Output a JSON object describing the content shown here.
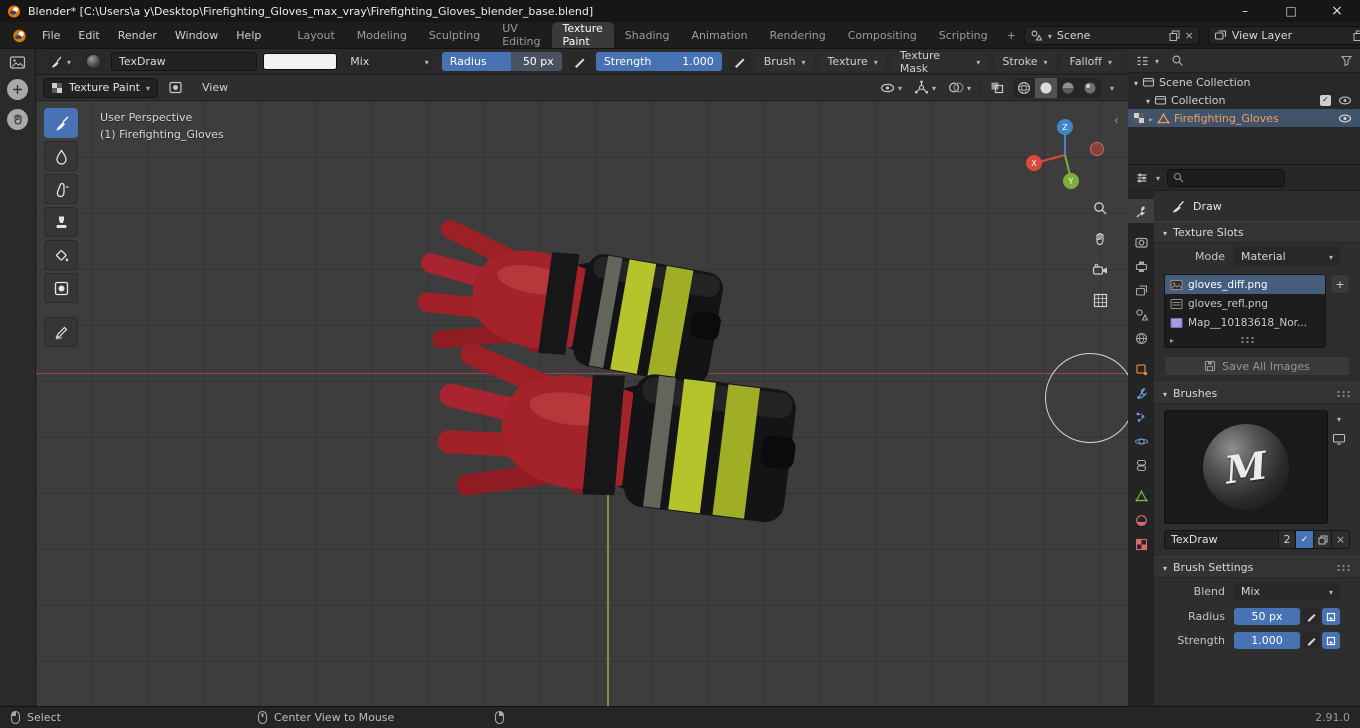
{
  "titlebar": {
    "title": "Blender* [C:\\Users\\a y\\Desktop\\Firefighting_Gloves_max_vray\\Firefighting_Gloves_blender_base.blend]"
  },
  "menubar": {
    "menus": [
      "File",
      "Edit",
      "Render",
      "Window",
      "Help"
    ],
    "tabs": [
      "Layout",
      "Modeling",
      "Sculpting",
      "UV Editing",
      "Texture Paint",
      "Shading",
      "Animation",
      "Rendering",
      "Compositing",
      "Scripting"
    ],
    "add_tab": "+",
    "scene": "Scene",
    "view_layer": "View Layer"
  },
  "tool_settings": {
    "brush_name": "TexDraw",
    "blend_mode": "Mix",
    "radius_label": "Radius",
    "radius_value": "50 px",
    "strength_label": "Strength",
    "strength_value": "1.000",
    "popovers": [
      "Brush",
      "Texture",
      "Texture Mask",
      "Stroke",
      "Falloff"
    ]
  },
  "viewport_header": {
    "mode": "Texture Paint",
    "view_menu": "View"
  },
  "viewport": {
    "perspective_label": "User Perspective",
    "object_label": "(1) Firefighting_Gloves",
    "axes": {
      "x": "X",
      "y": "Y",
      "z": "Z"
    }
  },
  "outliner": {
    "scene_collection": "Scene Collection",
    "collection": "Collection",
    "object": "Firefighting_Gloves"
  },
  "properties": {
    "tool_label": "Draw",
    "texture_slots_section": "Texture Slots",
    "mode_label": "Mode",
    "mode_value": "Material",
    "textures": [
      "gloves_diff.png",
      "gloves_refl.png",
      "Map__10183618_Nor..."
    ],
    "add_texture": "+",
    "save_all_images": "Save All Images",
    "brushes_section": "Brushes",
    "brush_name": "TexDraw",
    "brush_users": "2",
    "brush_settings_section": "Brush Settings",
    "blend_label": "Blend",
    "blend_value": "Mix",
    "radius_label": "Radius",
    "radius_value": "50 px",
    "strength_label": "Strength",
    "strength_value": "1.000"
  },
  "statusbar": {
    "select": "Select",
    "center_view": "Center View to Mouse",
    "version": "2.91.0"
  },
  "colors": {
    "accent": "#4772b3",
    "axis_x": "#d94a3d",
    "axis_y": "#7fae3a",
    "axis_z": "#3f87c9",
    "glove_red": "#a42229",
    "stripe_yellow": "#b6c42c"
  }
}
